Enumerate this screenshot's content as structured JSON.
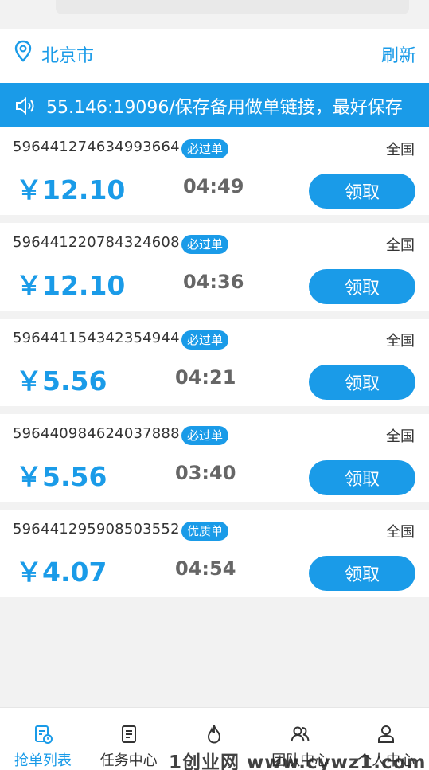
{
  "location": {
    "city": "北京市",
    "refresh_label": "刷新"
  },
  "notice": {
    "text": "55.146:19096/保存备用做单链接，最好保存"
  },
  "orders": [
    {
      "id": "596441274634993664",
      "tag": "必过单",
      "region": "全国",
      "price": "￥12.10",
      "time": "04:49",
      "action": "领取"
    },
    {
      "id": "596441220784324608",
      "tag": "必过单",
      "region": "全国",
      "price": "￥12.10",
      "time": "04:36",
      "action": "领取"
    },
    {
      "id": "596441154342354944",
      "tag": "必过单",
      "region": "全国",
      "price": "￥5.56",
      "time": "04:21",
      "action": "领取"
    },
    {
      "id": "596440984624037888",
      "tag": "必过单",
      "region": "全国",
      "price": "￥5.56",
      "time": "03:40",
      "action": "领取"
    },
    {
      "id": "596441295908503552",
      "tag": "优质单",
      "region": "全国",
      "price": "￥4.07",
      "time": "04:54",
      "action": "领取"
    }
  ],
  "tabs": [
    {
      "label": "抢单列表",
      "icon": "order-list-icon",
      "active": true
    },
    {
      "label": "任务中心",
      "icon": "task-doc-icon",
      "active": false
    },
    {
      "label": "",
      "icon": "fire-icon",
      "active": false
    },
    {
      "label": "团队中心",
      "icon": "team-icon",
      "active": false
    },
    {
      "label": "个人中心",
      "icon": "person-icon",
      "active": false
    }
  ],
  "watermark": "1创业网 www.cywz1.com",
  "colors": {
    "accent": "#1a9be8",
    "background": "#f2f2f2",
    "card": "#ffffff"
  }
}
